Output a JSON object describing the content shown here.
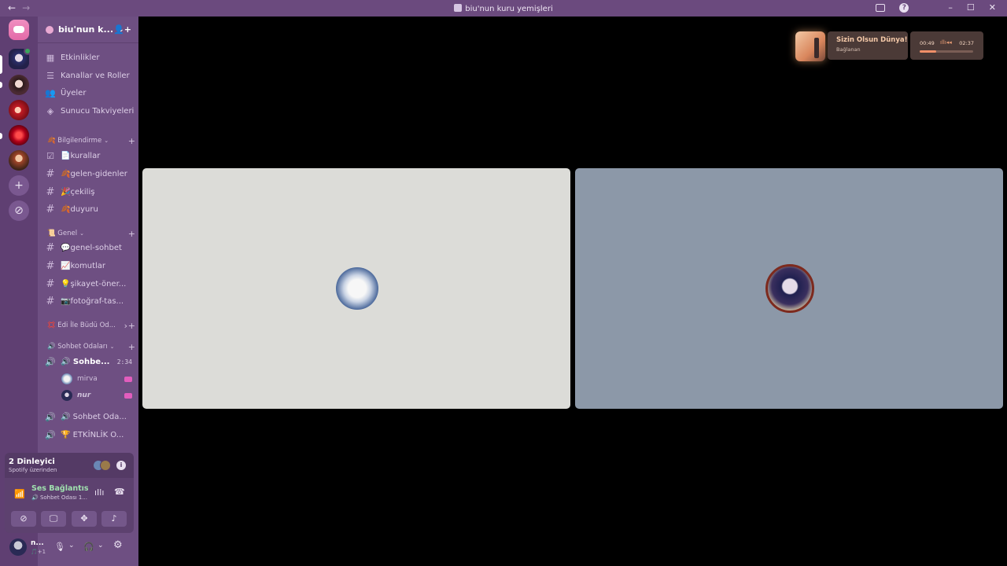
{
  "window": {
    "title": "biu'nun kuru yemişleri",
    "back": "←",
    "forward": "→",
    "help": "?",
    "minimize": "–",
    "maximize": "☐",
    "close": "✕"
  },
  "guild": {
    "name": "biu'nun k...",
    "chevron": "⌄",
    "invite_icon": "👤+"
  },
  "menu": [
    {
      "label": "Etkinlikler",
      "icon": "▦"
    },
    {
      "label": "Kanallar ve Roller",
      "icon": "☰"
    },
    {
      "label": "Üyeler",
      "icon": "👥"
    },
    {
      "label": "Sunucu Takviyeleri",
      "icon": "◈"
    }
  ],
  "categories": {
    "bilgi": {
      "label": "🍂 Bilgilendirme",
      "chevron": "⌄",
      "plus": "+"
    },
    "genel": {
      "label": "📜 Genel",
      "chevron": "⌄",
      "plus": "+"
    },
    "edi": {
      "label": "💢 Edi İle Büdü Od...",
      "chevron": "›",
      "plus": "+"
    },
    "sohbet": {
      "label": "🔊 Sohbet Odaları",
      "chevron": "⌄",
      "plus": "+"
    }
  },
  "channels": {
    "kurallar": "📄kurallar",
    "gelen": "🍂gelen-gidenler",
    "cekilis": "🎉çekiliş",
    "duyuru": "🍂duyuru",
    "genel_sohbet": "💬genel-sohbet",
    "komutlar": "📈komutlar",
    "sikayet": "💡şikayet-öner...",
    "fotograf": "📷fotoğraf-tas..."
  },
  "voice": {
    "active": {
      "label": "🔊 Sohbe...",
      "timer": "2:34"
    },
    "users": [
      {
        "name": "mirva"
      },
      {
        "name": "nur"
      }
    ],
    "other1": "🔊 Sohbet Oda...",
    "other2": "🏆 ETKİNLİK O..."
  },
  "activity": {
    "listeners": "2 Dinleyici",
    "source": "Spotify üzerinden",
    "info": "i"
  },
  "rtc": {
    "status": "Ses Bağlantısı K",
    "channel": "🔊 Sohbet Odası 1..."
  },
  "user": {
    "name": "n...",
    "status": "🎵+1"
  },
  "now_playing": {
    "title": "Sizin Olsun Dünya!",
    "artist": "Bağlanan",
    "current": "00:49",
    "total": "02:37",
    "progress_fraction": 0.31
  },
  "colors": {
    "sidebar": "#6e4f82",
    "server_rail": "#5f3f72",
    "titlebar": "#6b4a7e",
    "tile_left": "#dcdcd8",
    "tile_right": "#8c98a8",
    "speaking": "#3ba55d"
  },
  "icons": {
    "hash": "#",
    "speaker": "🔊",
    "rules": "☑",
    "signal": "📶",
    "noise": "ıIlı",
    "hangup": "☎",
    "camera_off": "⊘",
    "screen": "🖵",
    "activities": "✥",
    "soundboard": "♪",
    "mic": "🎙",
    "headset": "🎧",
    "gear": "⚙",
    "dropdown": "⌄"
  }
}
